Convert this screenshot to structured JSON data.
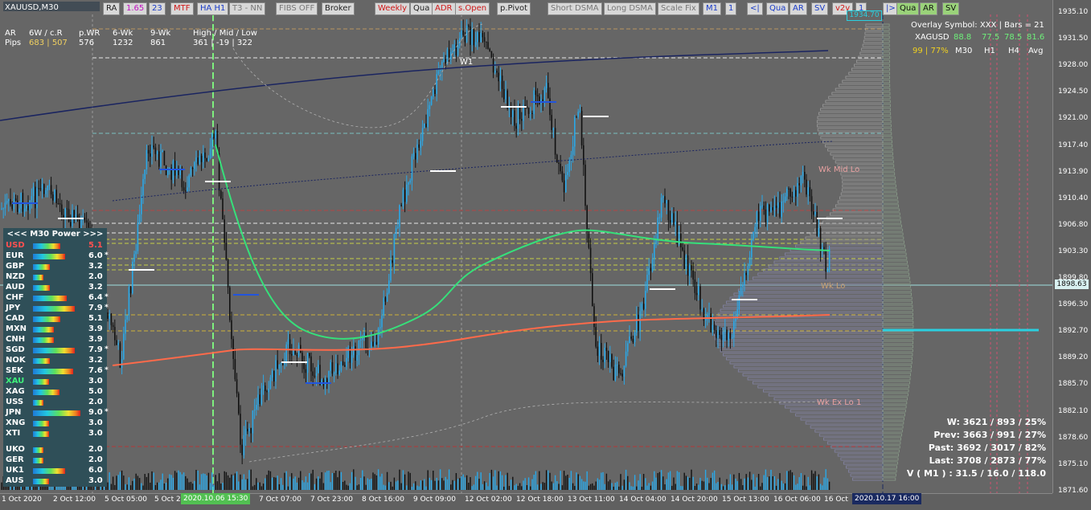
{
  "window": {
    "symbol_title": "XAUUSD,M30"
  },
  "toolbar": [
    {
      "label": "RA",
      "style": ""
    },
    {
      "label": "1.65",
      "style": "mag"
    },
    {
      "label": "23",
      "style": "blue"
    },
    {
      "label": "MTF",
      "style": "red"
    },
    {
      "label": "HA H1",
      "style": "blue"
    },
    {
      "label": "T3 - NN",
      "style": "grey"
    },
    {
      "label": "FIBS OFF",
      "style": "grey"
    },
    {
      "label": "Broker",
      "style": ""
    },
    {
      "label": "Weekly",
      "style": "red"
    },
    {
      "label": "Qua",
      "style": ""
    },
    {
      "label": "ADR",
      "style": "red"
    },
    {
      "label": "s.Open",
      "style": "red"
    },
    {
      "label": "p.Pivot",
      "style": ""
    },
    {
      "label": "Short DSMA",
      "style": "grey"
    },
    {
      "label": "Long DSMA",
      "style": "grey"
    },
    {
      "label": "Scale Fix",
      "style": "grey"
    },
    {
      "label": "M1",
      "style": "blue"
    },
    {
      "label": "1",
      "style": "blue"
    },
    {
      "label": "<|",
      "style": "blue"
    },
    {
      "label": "Qua",
      "style": "blue"
    },
    {
      "label": "AR",
      "style": "blue"
    },
    {
      "label": "SV",
      "style": "blue"
    },
    {
      "label": "v2v",
      "style": "red"
    },
    {
      "label": "1",
      "style": "blue"
    },
    {
      "label": "|>",
      "style": "blue"
    },
    {
      "label": "Qua",
      "style": "green"
    },
    {
      "label": "AR",
      "style": "green"
    },
    {
      "label": "SV",
      "style": "green"
    }
  ],
  "header_stats": {
    "row1": [
      "AR",
      "6W / c.R",
      "p.WR",
      "6-Wk",
      "9-Wk",
      "High / Mid / Low"
    ],
    "row2_label": "Pips",
    "row2": [
      "683 | 507",
      "576",
      "1232",
      "861",
      "361 | -19 | 322"
    ]
  },
  "overlay": {
    "title": "Overlay Symbol: XXX  |  Bars = 21",
    "symbol": "XAGUSD",
    "values": [
      "88.8",
      "77.5",
      "78.5",
      "81.6"
    ],
    "row3": [
      "99 | 77%",
      "M30",
      "H1",
      "H4",
      "Avg"
    ]
  },
  "power_panel": {
    "title": "<<<  M30   Power  >>>",
    "rows": [
      {
        "name": "USD",
        "value": "5.1",
        "strength": 0.51,
        "star": "",
        "color": "#ff5050"
      },
      {
        "name": "EUR",
        "value": "6.0",
        "strength": 0.6,
        "star": "*",
        "color": "#ffffff"
      },
      {
        "name": "GBP",
        "value": "3.2",
        "strength": 0.32,
        "star": "",
        "color": "#ffffff"
      },
      {
        "name": "NZD",
        "value": "2.0",
        "strength": 0.2,
        "star": "",
        "color": "#ffffff"
      },
      {
        "name": "AUD",
        "value": "3.2",
        "strength": 0.32,
        "star": "",
        "color": "#ffffff"
      },
      {
        "name": "CHF",
        "value": "6.4",
        "strength": 0.64,
        "star": "*",
        "color": "#ffffff"
      },
      {
        "name": "JPY",
        "value": "7.9",
        "strength": 0.79,
        "star": "*",
        "color": "#ffffff"
      },
      {
        "name": "CAD",
        "value": "5.1",
        "strength": 0.51,
        "star": "",
        "color": "#ffffff"
      },
      {
        "name": "MXN",
        "value": "3.9",
        "strength": 0.39,
        "star": "",
        "color": "#ffffff"
      },
      {
        "name": "CNH",
        "value": "3.9",
        "strength": 0.39,
        "star": "",
        "color": "#ffffff"
      },
      {
        "name": "SGD",
        "value": "7.9",
        "strength": 0.79,
        "star": "*",
        "color": "#ffffff"
      },
      {
        "name": "NOK",
        "value": "3.2",
        "strength": 0.32,
        "star": "",
        "color": "#ffffff"
      },
      {
        "name": "SEK",
        "value": "7.6",
        "strength": 0.76,
        "star": "*",
        "color": "#ffffff"
      },
      {
        "name": "XAU",
        "value": "3.0",
        "strength": 0.3,
        "star": "",
        "color": "#3ef07a"
      },
      {
        "name": "XAG",
        "value": "5.0",
        "strength": 0.5,
        "star": "",
        "color": "#ffffff"
      },
      {
        "name": "USS",
        "value": "2.0",
        "strength": 0.2,
        "star": "",
        "color": "#ffffff"
      },
      {
        "name": "JPN",
        "value": "9.0",
        "strength": 0.9,
        "star": "*",
        "color": "#ffffff"
      },
      {
        "name": "XNG",
        "value": "3.0",
        "strength": 0.3,
        "star": "",
        "color": "#ffffff"
      },
      {
        "name": "XTI",
        "value": "3.0",
        "strength": 0.3,
        "star": "",
        "color": "#ffffff"
      },
      {
        "name": "UKO",
        "value": "2.0",
        "strength": 0.2,
        "star": "",
        "color": "#ffffff"
      },
      {
        "name": "GER",
        "value": "2.0",
        "strength": 0.2,
        "star": "",
        "color": "#ffffff"
      },
      {
        "name": "UK1",
        "value": "6.0",
        "strength": 0.6,
        "star": "",
        "color": "#ffffff"
      },
      {
        "name": "AUS",
        "value": "3.0",
        "strength": 0.3,
        "star": "",
        "color": "#ffffff"
      }
    ]
  },
  "price_axis": [
    "1935.10",
    "1931.50",
    "1928.00",
    "1924.50",
    "1921.00",
    "1917.40",
    "1913.90",
    "1910.40",
    "1906.80",
    "1903.30",
    "1899.80",
    "1896.30",
    "1892.70",
    "1889.20",
    "1885.70",
    "1882.10",
    "1878.60",
    "1875.10",
    "1871.60"
  ],
  "current_price": "1898.63",
  "top_price": "1934.70",
  "time_axis": [
    "1 Oct 2020",
    "2 Oct 12:00",
    "5 Oct 05:00",
    "5 Oct 2",
    "7 Oct 07:00",
    "7 Oct 23:00",
    "8 Oct 16:00",
    "9 Oct 09:00",
    "12 Oct 02:00",
    "12 Oct 18:00",
    "13 Oct 11:00",
    "14 Oct 04:00",
    "14 Oct 20:00",
    "15 Oct 13:00",
    "16 Oct 06:00",
    "16 Oct"
  ],
  "time_cursor": "2020.10.06 15:30",
  "time_right": "2020.10.17 16:00",
  "chart_labels": {
    "w1": "W1",
    "wk_mid_lo": "Wk Mid Lo",
    "wk_lo": "Wk Lo",
    "wk_ex_lo": "Wk Ex Lo 1"
  },
  "stats": [
    "W: 3621 / 893 / 25%",
    "Prev: 3663 / 991 / 27%",
    "Past: 3692 / 3017 / 82%",
    "Last: 3708 / 2873 / 77%",
    "V ( M1 ) : 31.5 / 16.0 / 118.0"
  ],
  "colors": {
    "bull": "#2aa8e8",
    "bear": "#111111",
    "ma_fast": "#36e07a",
    "ma_slow": "#ff6a4a",
    "cursor": "#7ef07e"
  }
}
